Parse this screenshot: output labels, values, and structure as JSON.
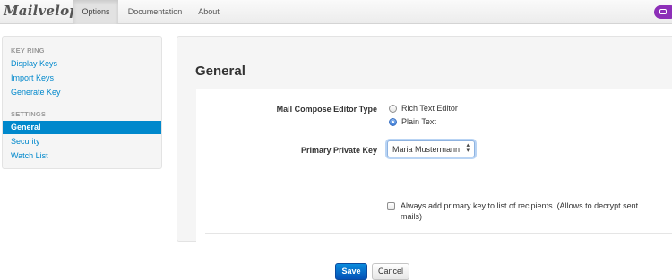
{
  "navbar": {
    "brand": "Mailvelope",
    "tabs": [
      {
        "label": "Options",
        "active": true
      },
      {
        "label": "Documentation",
        "active": false
      },
      {
        "label": "About",
        "active": false
      }
    ],
    "extension_icon": "mailvelope-lock-icon"
  },
  "sidebar": {
    "keyring_header": "KEY RING",
    "keyring_items": [
      {
        "label": "Display Keys"
      },
      {
        "label": "Import Keys"
      },
      {
        "label": "Generate Key"
      }
    ],
    "settings_header": "SETTINGS",
    "settings_items": [
      {
        "label": "General",
        "active": true
      },
      {
        "label": "Security",
        "active": false
      },
      {
        "label": "Watch List",
        "active": false
      }
    ]
  },
  "main": {
    "title": "General",
    "editor_type": {
      "label": "Mail Compose Editor Type",
      "options": [
        {
          "label": "Rich Text Editor",
          "checked": false
        },
        {
          "label": "Plain Text",
          "checked": true
        }
      ]
    },
    "primary_key": {
      "label": "Primary Private Key",
      "selected": "Maria Mustermann",
      "arrows": "⬍"
    },
    "always_add": {
      "label": "Always add primary key to list of recipients. (Allows to decrypt sent mails)",
      "checked": false
    },
    "buttons": {
      "save": "Save",
      "cancel": "Cancel"
    }
  },
  "colors": {
    "accent": "#0088cc",
    "save_button": "#0451b6",
    "extension_pill": "#8d2fb8"
  }
}
